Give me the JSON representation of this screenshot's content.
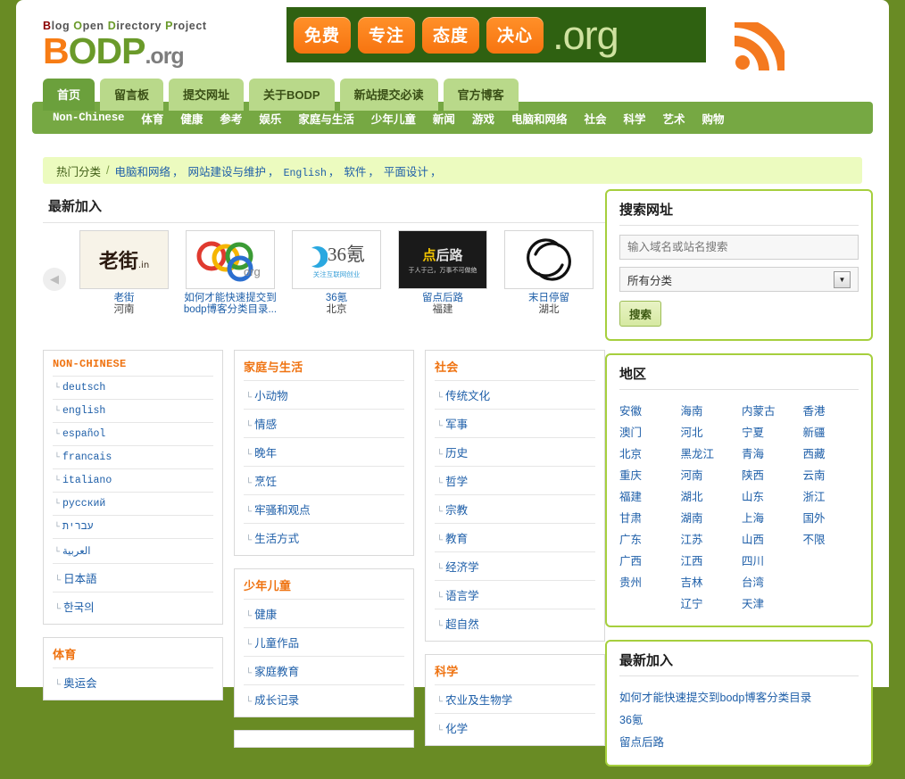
{
  "site": {
    "tagline_parts": [
      {
        "initial": "B",
        "rest": "log",
        "color": "#8b0000"
      },
      {
        "initial": "O",
        "rest": "pen",
        "color": "#6a9a2a"
      },
      {
        "initial": "D",
        "rest": "irectory",
        "color": "#6a9a2a"
      },
      {
        "initial": "P",
        "rest": "roject",
        "color": "#6a9a2a"
      }
    ],
    "logo": {
      "b": "B",
      "o": "O",
      "d": "D",
      "p": "P",
      "tld": ".org"
    },
    "colors": {
      "brand_orange": "#f77c14",
      "brand_green": "#6a9a2a",
      "page_bg": "#698b24",
      "accent_link": "#1d5ea8",
      "cat_title": "#ef7311",
      "panel_border": "#a6cf3d"
    }
  },
  "banner": {
    "chips": [
      "免费",
      "专注",
      "态度",
      "决心"
    ],
    "domain": ".org",
    "rss_icon": "rss-icon"
  },
  "tabs": [
    {
      "label": "首页",
      "active": true
    },
    {
      "label": "留言板",
      "active": false
    },
    {
      "label": "提交网址",
      "active": false
    },
    {
      "label": "关于BODP",
      "active": false
    },
    {
      "label": "新站提交必读",
      "active": false
    },
    {
      "label": "官方博客",
      "active": false
    }
  ],
  "nav": [
    {
      "label": "Non-Chinese",
      "mono": true
    },
    {
      "label": "体育",
      "mono": false
    },
    {
      "label": "健康",
      "mono": false
    },
    {
      "label": "参考",
      "mono": false
    },
    {
      "label": "娱乐",
      "mono": false
    },
    {
      "label": "家庭与生活",
      "mono": false
    },
    {
      "label": "少年儿童",
      "mono": false
    },
    {
      "label": "新闻",
      "mono": false
    },
    {
      "label": "游戏",
      "mono": false
    },
    {
      "label": "电脑和网络",
      "mono": false
    },
    {
      "label": "社会",
      "mono": false
    },
    {
      "label": "科学",
      "mono": false
    },
    {
      "label": "艺术",
      "mono": false
    },
    {
      "label": "购物",
      "mono": false
    }
  ],
  "hotbar": {
    "label": "热门分类",
    "separator": "/",
    "items": [
      {
        "label": "电脑和网络",
        "mono": false
      },
      {
        "label": "网站建设与维护",
        "mono": false
      },
      {
        "label": "English",
        "mono": true
      },
      {
        "label": "软件",
        "mono": false
      },
      {
        "label": "平面设计",
        "mono": false
      }
    ],
    "comma": "，"
  },
  "latest_section": {
    "title": "最新加入",
    "prev_icon": "chevron-left-icon",
    "next_icon": "chevron-right-icon",
    "items": [
      {
        "label": "老街",
        "region": "河南",
        "thumb": "laojie"
      },
      {
        "label": "如何才能快速提交到bodp博客分类目录...",
        "region": "",
        "thumb": "bodp"
      },
      {
        "label": "36氪",
        "region": "北京",
        "thumb": "k36"
      },
      {
        "label": "留点后路",
        "region": "福建",
        "thumb": "liudian"
      },
      {
        "label": "末日停留",
        "region": "湖北",
        "thumb": "moriduan"
      }
    ]
  },
  "category_columns": [
    [
      {
        "title": "NON-CHINESE",
        "mono": true,
        "items": [
          {
            "label": "deutsch",
            "mono": true
          },
          {
            "label": "english",
            "mono": true
          },
          {
            "label": "español",
            "mono": true
          },
          {
            "label": "francais",
            "mono": true
          },
          {
            "label": "italiano",
            "mono": true
          },
          {
            "label": "русский",
            "mono": true
          },
          {
            "label": "עברית",
            "mono": true
          },
          {
            "label": "العربية",
            "mono": true
          },
          {
            "label": "日本語",
            "mono": false
          },
          {
            "label": "한국의",
            "mono": false
          }
        ]
      },
      {
        "title": "体育",
        "mono": false,
        "items": [
          {
            "label": "奥运会",
            "mono": false
          }
        ]
      }
    ],
    [
      {
        "title": "家庭与生活",
        "mono": false,
        "items": [
          {
            "label": "小动物",
            "mono": false
          },
          {
            "label": "情感",
            "mono": false
          },
          {
            "label": "晚年",
            "mono": false
          },
          {
            "label": "烹饪",
            "mono": false
          },
          {
            "label": "牢骚和观点",
            "mono": false
          },
          {
            "label": "生活方式",
            "mono": false
          }
        ]
      },
      {
        "title": "少年儿童",
        "mono": false,
        "items": [
          {
            "label": "健康",
            "mono": false
          },
          {
            "label": "儿童作品",
            "mono": false
          },
          {
            "label": "家庭教育",
            "mono": false
          },
          {
            "label": "成长记录",
            "mono": false
          }
        ]
      },
      {
        "title": "",
        "mono": false,
        "items": []
      }
    ],
    [
      {
        "title": "社会",
        "mono": false,
        "items": [
          {
            "label": "传统文化",
            "mono": false
          },
          {
            "label": "军事",
            "mono": false
          },
          {
            "label": "历史",
            "mono": false
          },
          {
            "label": "哲学",
            "mono": false
          },
          {
            "label": "宗教",
            "mono": false
          },
          {
            "label": "教育",
            "mono": false
          },
          {
            "label": "经济学",
            "mono": false
          },
          {
            "label": "语言学",
            "mono": false
          },
          {
            "label": "超自然",
            "mono": false
          }
        ]
      },
      {
        "title": "科学",
        "mono": false,
        "items": [
          {
            "label": "农业及生物学",
            "mono": false
          },
          {
            "label": "化学",
            "mono": false
          }
        ]
      }
    ]
  ],
  "search_panel": {
    "title": "搜索网址",
    "input_placeholder": "输入域名或站名搜索",
    "input_value": "",
    "select_value": "所有分类",
    "select_icon": "chevron-down-icon",
    "button_label": "搜索"
  },
  "region_panel": {
    "title": "地区",
    "columns": [
      [
        "安徽",
        "澳门",
        "北京",
        "重庆",
        "福建",
        "甘肃",
        "广东",
        "广西",
        "贵州"
      ],
      [
        "海南",
        "河北",
        "黑龙江",
        "河南",
        "湖北",
        "湖南",
        "江苏",
        "江西",
        "吉林",
        "辽宁"
      ],
      [
        "内蒙古",
        "宁夏",
        "青海",
        "陕西",
        "山东",
        "上海",
        "山西",
        "四川",
        "台湾",
        "天津"
      ],
      [
        "香港",
        "新疆",
        "西藏",
        "云南",
        "浙江",
        "国外",
        "不限"
      ]
    ]
  },
  "new_panel": {
    "title": "最新加入",
    "links": [
      "如何才能快速提交到bodp博客分类目录",
      "36氪",
      "留点后路"
    ]
  }
}
